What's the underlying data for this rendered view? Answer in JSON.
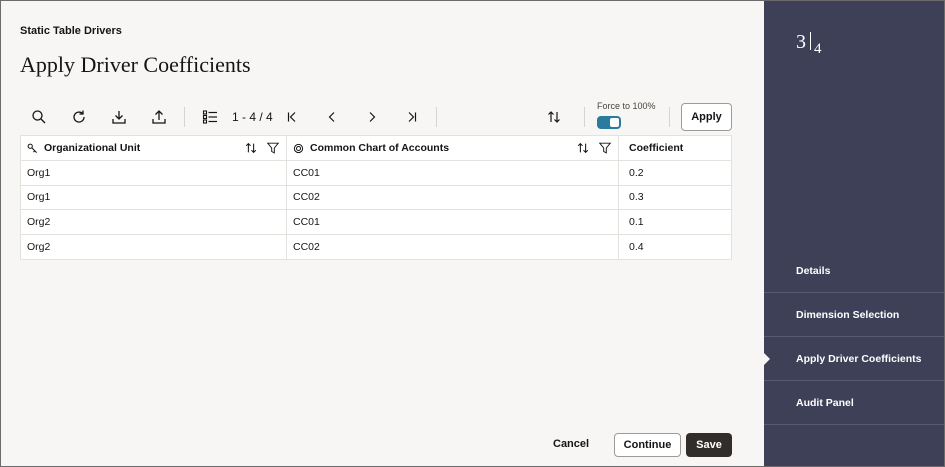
{
  "header": {
    "eyebrow": "Static Table Drivers",
    "title": "Apply Driver Coefficients"
  },
  "toolbar": {
    "icons": [
      "search-icon",
      "refresh-icon",
      "download-icon",
      "upload-icon",
      "list-icon",
      "first-page-icon",
      "previous-page-icon",
      "next-page-icon",
      "last-page-icon",
      "sort-icon"
    ],
    "pager_text": "1 - 4 / 4",
    "force_label": "Force to 100%",
    "force_enabled": true,
    "apply_label": "Apply"
  },
  "table": {
    "columns": [
      {
        "label": "Organizational Unit",
        "icon": "key-icon"
      },
      {
        "label": "Common Chart of Accounts",
        "icon": "target-icon"
      },
      {
        "label": "Coefficient"
      }
    ],
    "rows": [
      {
        "org": "Org1",
        "account": "CC01",
        "coefficient": "0.2"
      },
      {
        "org": "Org1",
        "account": "CC02",
        "coefficient": "0.3"
      },
      {
        "org": "Org2",
        "account": "CC01",
        "coefficient": "0.1"
      },
      {
        "org": "Org2",
        "account": "CC02",
        "coefficient": "0.4"
      }
    ]
  },
  "footer": {
    "cancel_label": "Cancel",
    "continue_label": "Continue",
    "save_label": "Save"
  },
  "sidebar": {
    "current_step": "3",
    "total_steps": "4",
    "steps": [
      {
        "label": "Details"
      },
      {
        "label": "Dimension Selection"
      },
      {
        "label": "Apply Driver Coefficients",
        "active": true
      },
      {
        "label": "Audit Panel"
      }
    ]
  },
  "colors": {
    "sidebar_bg": "#3e4058",
    "main_bg": "#f7f6f4",
    "toggle_on": "#2b7b9c",
    "save_bg": "#312d2a"
  }
}
